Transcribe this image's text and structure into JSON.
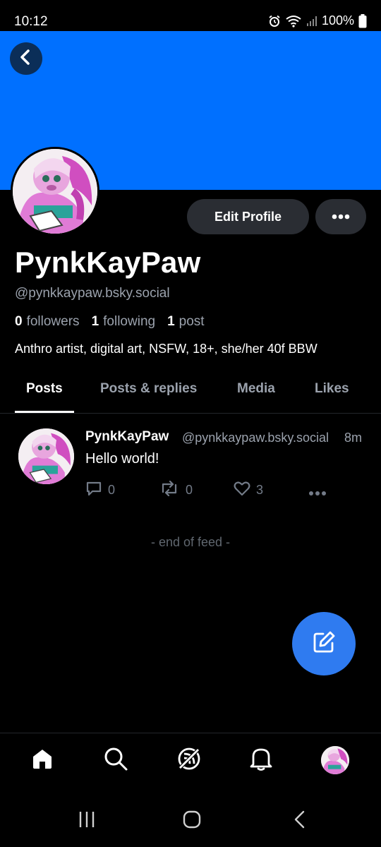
{
  "status_bar": {
    "time": "10:12",
    "battery": "100%"
  },
  "banner": {
    "color": "#0070ff"
  },
  "profile": {
    "edit_label": "Edit Profile",
    "display_name": "PynkKayPaw",
    "handle": "@pynkkaypaw.bsky.social",
    "followers_count": "0",
    "followers_label": "followers",
    "following_count": "1",
    "following_label": "following",
    "posts_count": "1",
    "posts_label": "post",
    "bio": "Anthro artist, digital art, NSFW, 18+, she/her 40f BBW"
  },
  "tabs": [
    {
      "label": "Posts",
      "active": true
    },
    {
      "label": "Posts & replies",
      "active": false
    },
    {
      "label": "Media",
      "active": false
    },
    {
      "label": "Likes",
      "active": false
    }
  ],
  "post": {
    "author": "PynkKayPaw",
    "handle": "@pynkkaypaw.bsky.social",
    "time": "8m",
    "text": "Hello world!",
    "reply_count": "0",
    "repost_count": "0",
    "like_count": "3"
  },
  "feed": {
    "end_label": "- end of feed -"
  },
  "colors": {
    "accent": "#2f7bf0",
    "muted_text": "#9ba2ad",
    "button_bg": "#2a2d33"
  }
}
